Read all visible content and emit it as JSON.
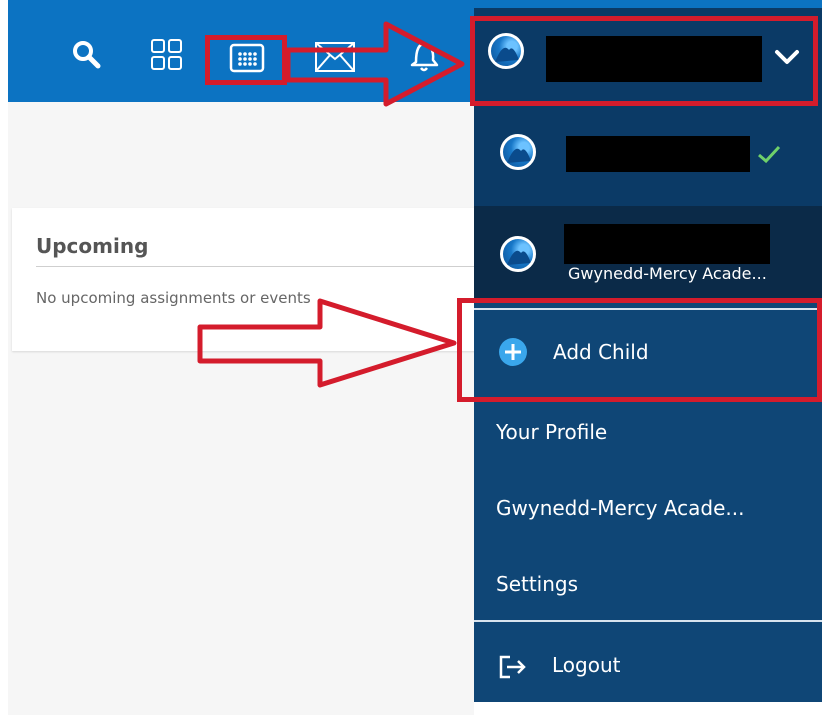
{
  "topbar": {
    "icons": [
      "search-icon",
      "apps-grid-icon",
      "calendar-icon",
      "mail-icon",
      "notifications-bell-icon"
    ],
    "chevron": "chevron-down-icon",
    "bg_color": "#0c73c2"
  },
  "upcoming": {
    "title": "Upcoming",
    "empty_message": "No upcoming assignments or events"
  },
  "dropdown": {
    "second_account_school": "Gwynedd-Mercy Acade...",
    "add_child_label": "Add Child",
    "your_profile_label": "Your Profile",
    "school_label": "Gwynedd-Mercy Acade...",
    "settings_label": "Settings",
    "logout_label": "Logout",
    "bg_color": "#0f4676",
    "selected_color": "#0b3a66",
    "check_color": "#6fd06a"
  },
  "annotation_color": "#d41c2c"
}
